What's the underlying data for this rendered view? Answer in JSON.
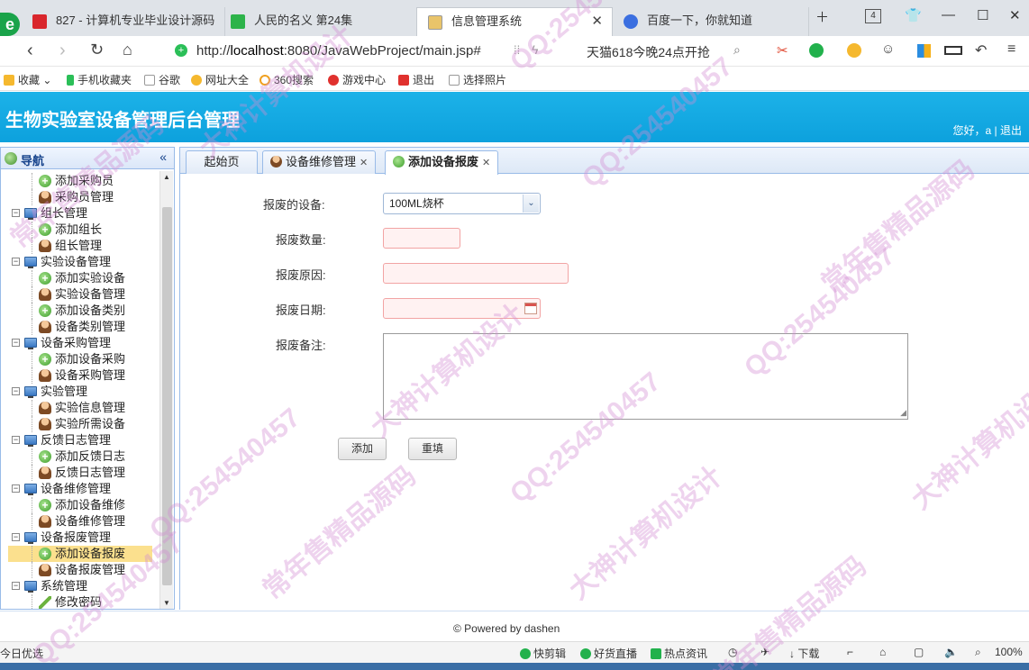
{
  "browser": {
    "tabs": [
      {
        "label": "827 - 计算机专业毕业设计源码"
      },
      {
        "label": "人民的名义 第24集"
      },
      {
        "label": "信息管理系统"
      },
      {
        "label": "百度一下，你就知道"
      }
    ],
    "tab_count": "4",
    "url_prefix": "http://",
    "url_host": "localhost",
    "url_rest": ":8080/JavaWebProject/main.jsp#",
    "promo": "天猫618今晚24点开抢",
    "bookmarks": [
      "收藏",
      "手机收藏夹",
      "谷歌",
      "网址大全",
      "360搜索",
      "游戏中心",
      "退出",
      "选择照片"
    ],
    "status_left": "今日优选",
    "status_items": [
      "快剪辑",
      "好货直播",
      "热点资讯",
      "下载"
    ],
    "zoom": "100%"
  },
  "app": {
    "title": "生物实验室设备管理后台管理",
    "user_prefix": "您好，a",
    "logout": "退出"
  },
  "nav": {
    "title": "导航",
    "collapse_icon": "«",
    "items": [
      {
        "label": "添加采购员",
        "level": 1,
        "icon": "add"
      },
      {
        "label": "采购员管理",
        "level": 1,
        "icon": "user"
      },
      {
        "label": "组长管理",
        "level": 0
      },
      {
        "label": "添加组长",
        "level": 1,
        "icon": "add"
      },
      {
        "label": "组长管理",
        "level": 1,
        "icon": "user"
      },
      {
        "label": "实验设备管理",
        "level": 0
      },
      {
        "label": "添加实验设备",
        "level": 1,
        "icon": "add"
      },
      {
        "label": "实验设备管理",
        "level": 1,
        "icon": "user"
      },
      {
        "label": "添加设备类别",
        "level": 1,
        "icon": "add"
      },
      {
        "label": "设备类别管理",
        "level": 1,
        "icon": "user"
      },
      {
        "label": "设备采购管理",
        "level": 0
      },
      {
        "label": "添加设备采购",
        "level": 1,
        "icon": "add"
      },
      {
        "label": "设备采购管理",
        "level": 1,
        "icon": "user"
      },
      {
        "label": "实验管理",
        "level": 0
      },
      {
        "label": "实验信息管理",
        "level": 1,
        "icon": "user"
      },
      {
        "label": "实验所需设备",
        "level": 1,
        "icon": "user"
      },
      {
        "label": "反馈日志管理",
        "level": 0
      },
      {
        "label": "添加反馈日志",
        "level": 1,
        "icon": "add"
      },
      {
        "label": "反馈日志管理",
        "level": 1,
        "icon": "user"
      },
      {
        "label": "设备维修管理",
        "level": 0
      },
      {
        "label": "添加设备维修",
        "level": 1,
        "icon": "add"
      },
      {
        "label": "设备维修管理",
        "level": 1,
        "icon": "user"
      },
      {
        "label": "设备报废管理",
        "level": 0
      },
      {
        "label": "添加设备报废",
        "level": 1,
        "icon": "add",
        "selected": true
      },
      {
        "label": "设备报废管理",
        "level": 1,
        "icon": "user"
      },
      {
        "label": "系统管理",
        "level": 0
      },
      {
        "label": "修改密码",
        "level": 1,
        "icon": "pencil"
      }
    ]
  },
  "tabs": [
    {
      "label": "起始页"
    },
    {
      "label": "设备维修管理"
    },
    {
      "label": "添加设备报废"
    }
  ],
  "form": {
    "device_label": "报废的设备:",
    "device_value": "100ML烧杯",
    "quantity_label": "报废数量:",
    "quantity_value": "",
    "reason_label": "报废原因:",
    "reason_value": "",
    "date_label": "报废日期:",
    "date_value": "",
    "remark_label": "报废备注:",
    "remark_value": "",
    "submit_label": "添加",
    "reset_label": "重填"
  },
  "footer": "© Powered by dashen",
  "watermarks": [
    "QQ:254540457",
    "常年售精品源码",
    "大神计算机设计"
  ],
  "colors": {
    "header": "#0da1dd",
    "selected_nav": "#fbe08e",
    "invalid_field": "#fff2f2"
  }
}
